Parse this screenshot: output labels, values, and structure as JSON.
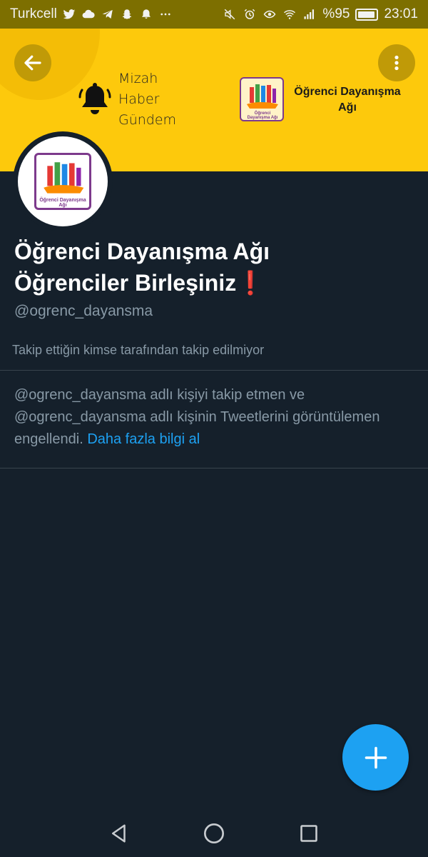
{
  "status_bar": {
    "carrier": "Turkcell",
    "battery": "%95",
    "battery_level": 0.95,
    "time": "23:01",
    "left_icons": [
      "twitter-icon",
      "cloud-icon",
      "telegram-icon",
      "snapchat-icon",
      "bell-icon",
      "more-dots-icon"
    ],
    "right_icons": [
      "mute-icon",
      "alarm-icon",
      "eye-icon",
      "wifi-icon",
      "signal-icon",
      "battery-icon"
    ]
  },
  "banner": {
    "bg_color": "#fdc90c",
    "bell_text": [
      "Mizah",
      "Haber",
      "Gündem"
    ],
    "logo_text": "Öğrenci Dayanışma Ağı",
    "logo_small_text": "Öğrenci Dayanışma Ağı"
  },
  "header": {
    "back_icon": "arrow-left-icon",
    "more_icon": "vertical-dots-icon"
  },
  "profile": {
    "avatar_logo_text": "Öğrenci Dayanışma Ağı",
    "name_line1": "Öğrenci Dayanışma Ağı",
    "name_line2": "Öğrenciler Birleşiniz",
    "name_emoji": "❗",
    "handle": "@ogrenc_dayansma",
    "follow_note": "Takip ettiğin kimse tarafından takip edilmiyor"
  },
  "blocked_notice": {
    "text": "@ogrenc_dayansma adlı kişiyi takip etmen ve @ogrenc_dayansma adlı kişinin Tweetlerini görüntülemen engellendi.",
    "link": "Daha fazla bilgi al",
    "link_color": "#1da1f2"
  },
  "fab": {
    "icon": "plus-icon",
    "color": "#1da1f2"
  },
  "nav_bar": {
    "icons": [
      "back-triangle-icon",
      "home-circle-icon",
      "recents-square-icon"
    ]
  }
}
